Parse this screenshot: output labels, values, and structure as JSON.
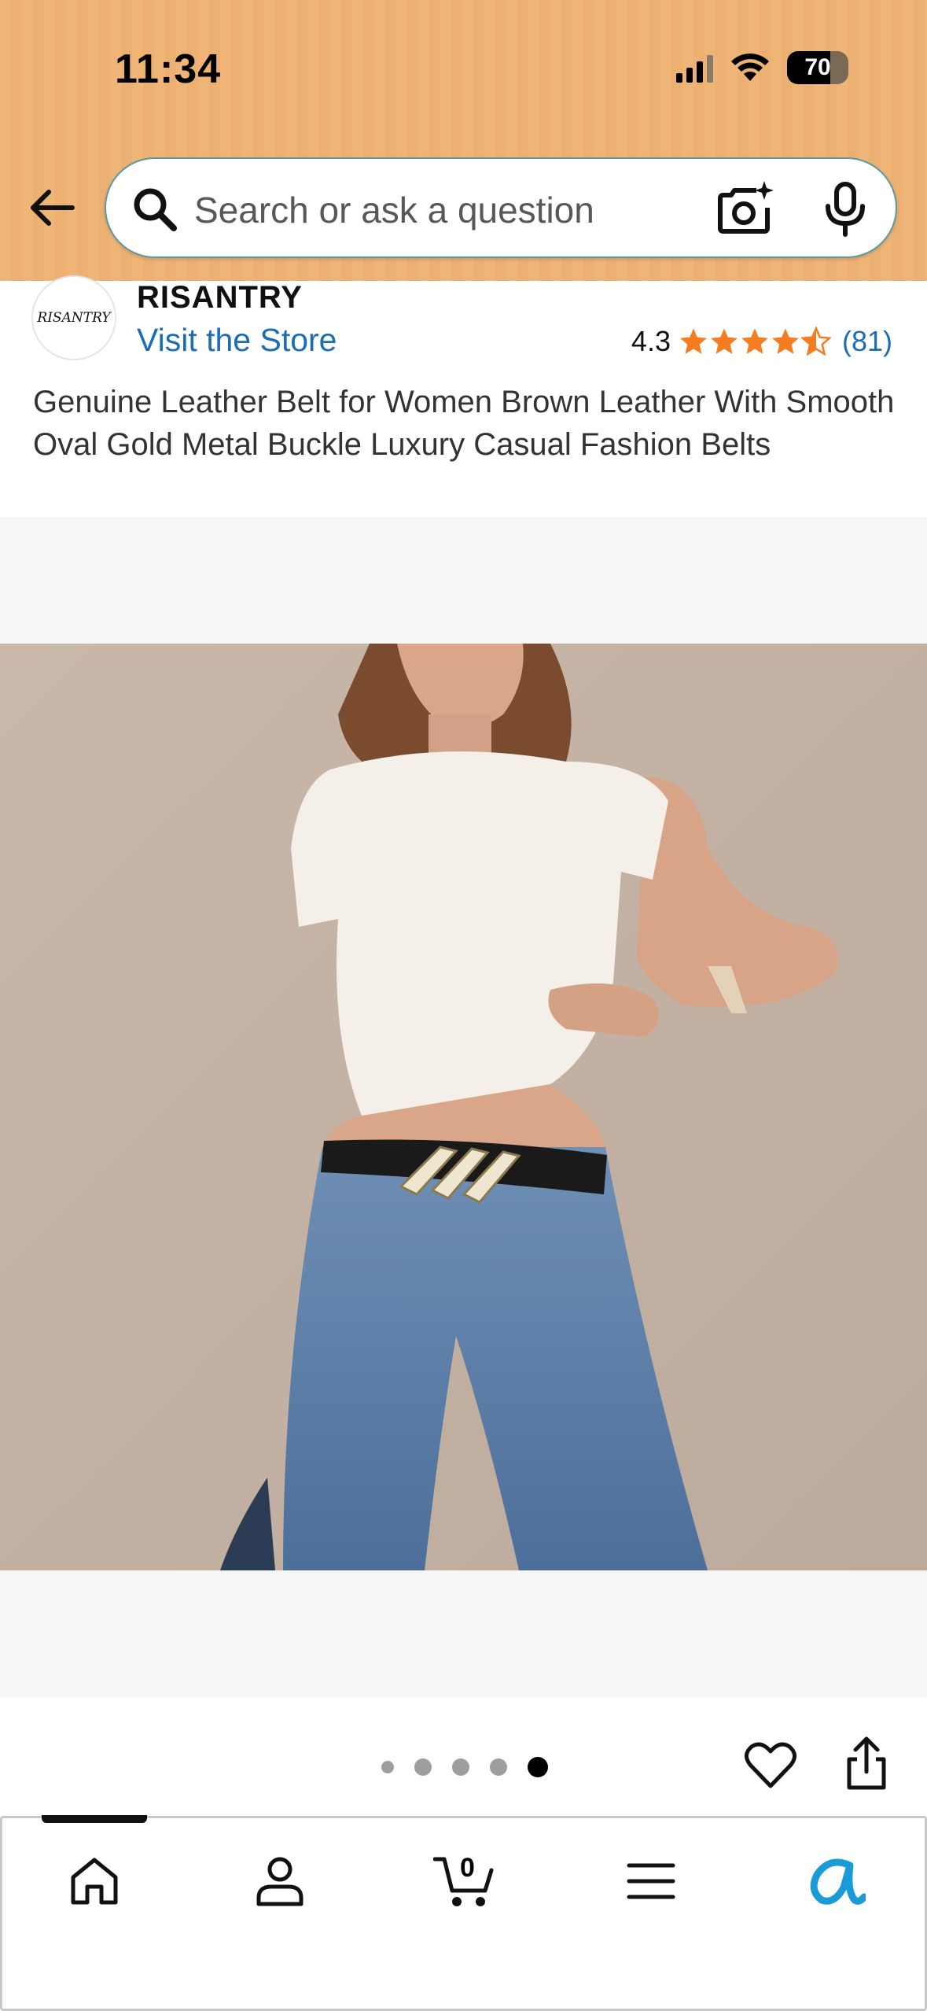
{
  "status_bar": {
    "time": "11:34",
    "battery": "70"
  },
  "search": {
    "placeholder": "Search or ask a question"
  },
  "store": {
    "logo_text": "RISANTRY",
    "brand": "RISANTRY",
    "visit_label": "Visit the Store",
    "rating": "4.3",
    "stars": 4.3,
    "review_count": "(81)"
  },
  "product": {
    "title": "Genuine Leather Belt for Women Brown Leather With Smooth Oval Gold Metal Buckle Luxury Casual Fashion Belts"
  },
  "gallery": {
    "total_images": 5,
    "active_index": 4
  },
  "bottom_nav": {
    "items": [
      "home-icon",
      "account-icon",
      "cart-icon",
      "menu-icon",
      "rufus-icon"
    ],
    "cart_count": "0",
    "active": "home"
  },
  "colors": {
    "header_bg": "#efb577",
    "link": "#1b6db5",
    "star": "#f57c1f",
    "rufus_accent": "#1a9bd7"
  }
}
